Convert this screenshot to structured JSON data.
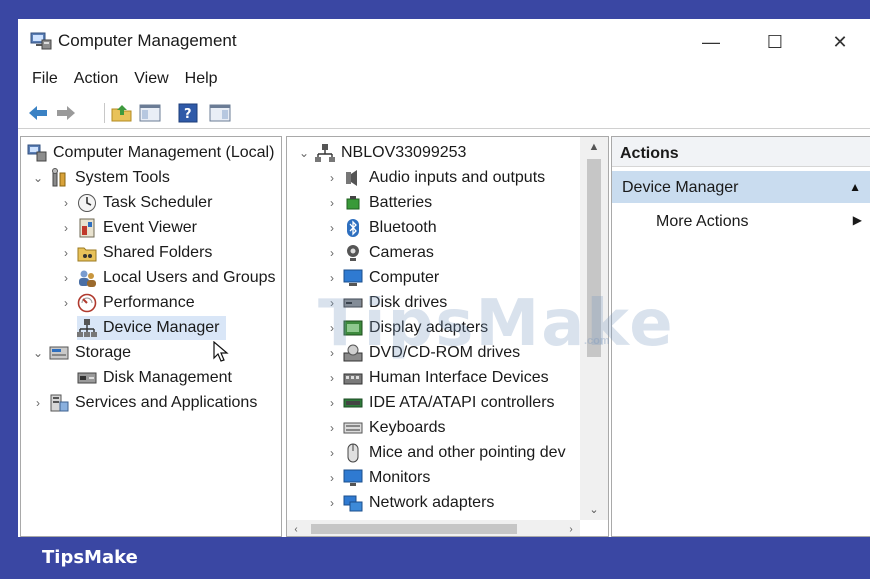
{
  "window": {
    "title": "Computer Management",
    "controls": {
      "minimize": "—",
      "maximize": "☐",
      "close": "✕"
    }
  },
  "menu": [
    "File",
    "Action",
    "View",
    "Help"
  ],
  "toolbar": [
    "back-arrow-icon",
    "forward-arrow-icon",
    "up-folder-icon",
    "show-hide-tree-icon",
    "help-icon",
    "properties-icon"
  ],
  "left_tree": {
    "root": "Computer Management (Local)",
    "items": [
      {
        "label": "System Tools",
        "level": 1,
        "expander": "⌄"
      },
      {
        "label": "Task Scheduler",
        "level": 2,
        "expander": "›"
      },
      {
        "label": "Event Viewer",
        "level": 2,
        "expander": "›"
      },
      {
        "label": "Shared Folders",
        "level": 2,
        "expander": "›"
      },
      {
        "label": "Local Users and Groups",
        "level": 2,
        "expander": "›"
      },
      {
        "label": "Performance",
        "level": 2,
        "expander": "›"
      },
      {
        "label": "Device Manager",
        "level": 2,
        "expander": "",
        "selected": true
      },
      {
        "label": "Storage",
        "level": 1,
        "expander": "⌄"
      },
      {
        "label": "Disk Management",
        "level": 2,
        "expander": ""
      },
      {
        "label": "Services and Applications",
        "level": 1,
        "expander": "›"
      }
    ]
  },
  "device_tree": {
    "computer": "NBLOV33099253",
    "categories": [
      "Audio inputs and outputs",
      "Batteries",
      "Bluetooth",
      "Cameras",
      "Computer",
      "Disk drives",
      "Display adapters",
      "DVD/CD-ROM drives",
      "Human Interface Devices",
      "IDE ATA/ATAPI controllers",
      "Keyboards",
      "Mice and other pointing dev",
      "Monitors",
      "Network adapters"
    ]
  },
  "actions": {
    "header": "Actions",
    "section": "Device Manager",
    "more": "More Actions"
  },
  "watermark": {
    "main": "TipsMake",
    "suffix": ".com"
  },
  "brand": "TipsMake"
}
